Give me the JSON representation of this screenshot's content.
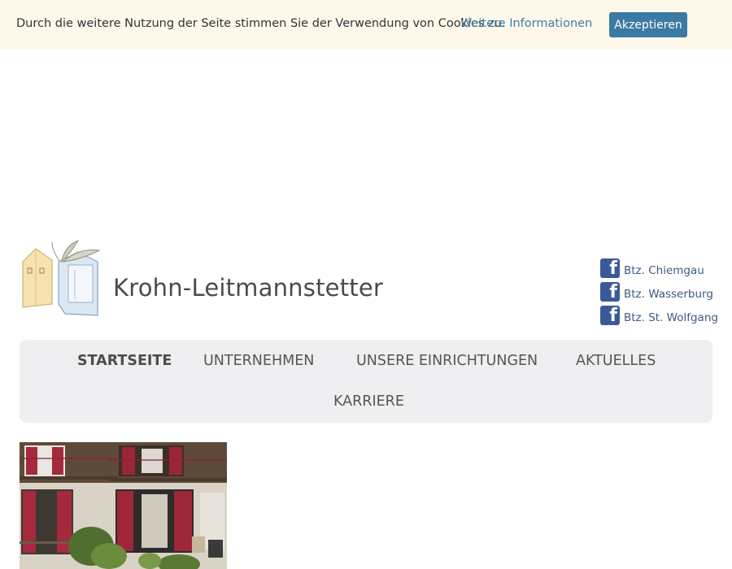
{
  "cookie": {
    "message": "Durch die weitere Nutzung der Seite stimmen Sie der Verwendung von Cookies zu.",
    "link_label": "Weitere Informationen",
    "accept_label": "Akzeptieren"
  },
  "header": {
    "site_title": "Krohn-Leitmannstetter"
  },
  "social": {
    "items": [
      {
        "label": "Btz. Chiemgau",
        "icon": "facebook-icon"
      },
      {
        "label": "Btz. Wasserburg",
        "icon": "facebook-icon"
      },
      {
        "label": "Btz. St. Wolfgang",
        "icon": "facebook-icon"
      }
    ]
  },
  "nav": {
    "items": [
      {
        "label": "STARTSEITE",
        "active": true
      },
      {
        "label": "UNTERNEHMEN",
        "active": false
      },
      {
        "label": "UNSERE EINRICHTUNGEN",
        "active": false
      },
      {
        "label": "AKTUELLES",
        "active": false
      },
      {
        "label": "KARRIERE",
        "active": false
      }
    ]
  },
  "colors": {
    "cookie_bg": "#fdf8ea",
    "accent": "#3b7ba3",
    "facebook": "#3b5998",
    "nav_bg": "#efeef1"
  }
}
